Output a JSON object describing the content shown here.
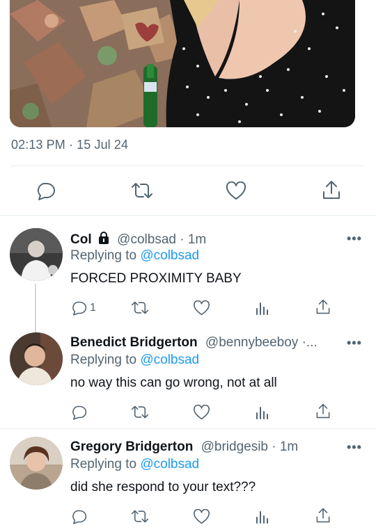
{
  "tweet": {
    "timestamp": "02:13 PM · 15 Jul 24",
    "actions": [
      "reply-icon",
      "retweet-icon",
      "like-icon",
      "share-icon"
    ]
  },
  "replies": [
    {
      "display_name": "Col",
      "locked": true,
      "meta": "@colbsad · 1m",
      "replying_prefix": "Replying to",
      "replying_to": "@colbsad",
      "text": "FORCED PROXIMITY BABY",
      "reply_count": "1",
      "more": "•••"
    },
    {
      "display_name": "Benedict Bridgerton",
      "locked": false,
      "meta": "@bennybeeboy ·...",
      "replying_prefix": "Replying to",
      "replying_to": "@colbsad",
      "text": "no way this can go wrong, not at all",
      "reply_count": "",
      "more": "•••"
    },
    {
      "display_name": "Gregory Bridgerton",
      "locked": false,
      "meta": "@bridgesib · 1m",
      "replying_prefix": "Replying to",
      "replying_to": "@colbsad",
      "text": "did she respond to your text???",
      "reply_count": "",
      "more": "•••"
    }
  ],
  "colors": {
    "accent": "#1d9bf0",
    "secondary_text": "#536471",
    "divider": "#e6ecf0"
  }
}
